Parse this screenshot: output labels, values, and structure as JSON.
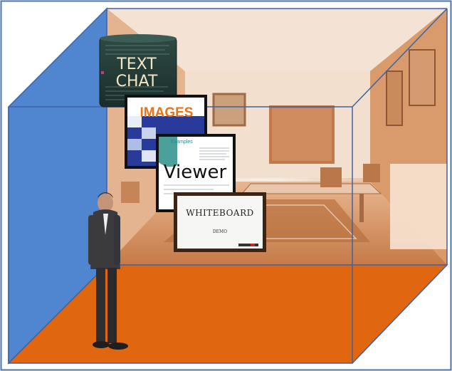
{
  "panels": {
    "text_chat": {
      "line1": "TEXT",
      "line2": "CHAT"
    },
    "images": {
      "label": "IMAGES"
    },
    "viewer": {
      "label": "Viewer",
      "slide_title": "Examples"
    },
    "whiteboard": {
      "label": "WHITEBOARD",
      "sub": "DEMO"
    }
  },
  "colors": {
    "left_wall": "#4f86cf",
    "floor": "#e0670f",
    "edge": "#3b63a8",
    "room_tint": "#d99a6c",
    "room_light": "#f6e7da"
  }
}
